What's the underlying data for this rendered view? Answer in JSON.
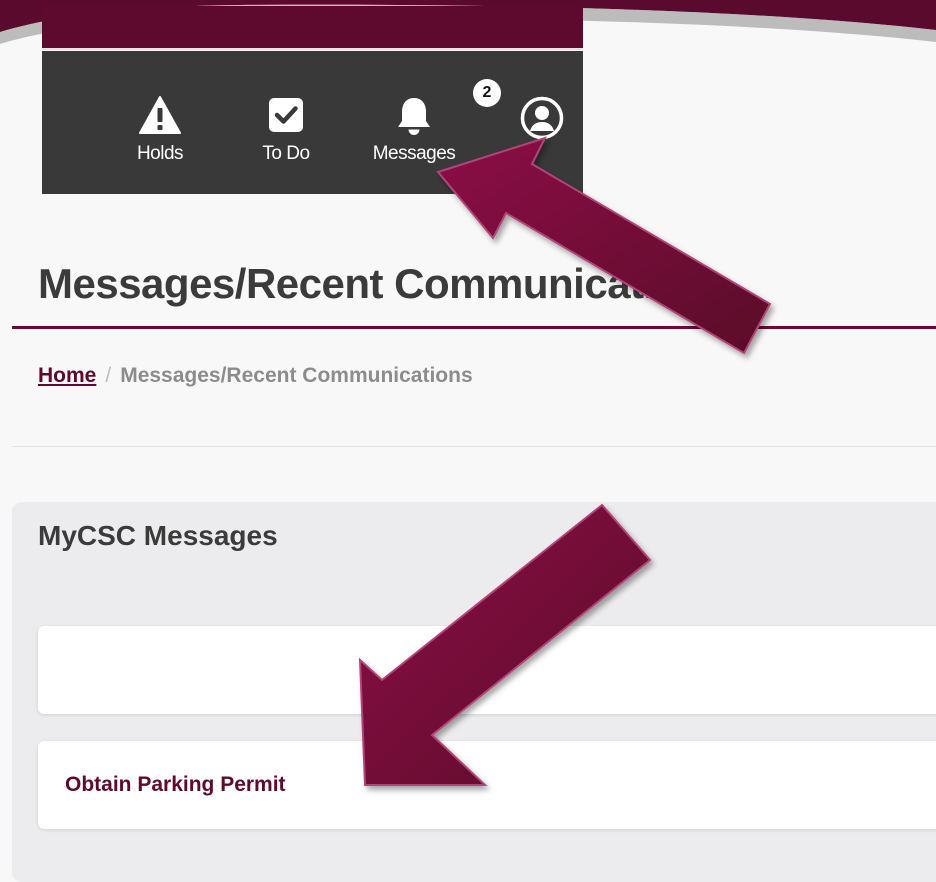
{
  "nav": {
    "items": [
      {
        "label": "Holds",
        "icon": "warning-icon"
      },
      {
        "label": "To Do",
        "icon": "checkbox-icon"
      },
      {
        "label": "Messages",
        "icon": "bell-icon",
        "badge": "2"
      },
      {
        "label": "",
        "icon": "user-profile-icon"
      }
    ]
  },
  "page": {
    "title": "Messages/Recent Communications"
  },
  "breadcrumb": {
    "home": "Home",
    "separator": "/",
    "current": "Messages/Recent Communications"
  },
  "messages": {
    "title": "MyCSC Messages",
    "items": [
      {
        "label": ""
      },
      {
        "label": "Obtain Parking Permit"
      }
    ]
  },
  "colors": {
    "brand": "#5e0a2e",
    "nav_bg": "#393939",
    "arrow": "#7a0a3a"
  }
}
